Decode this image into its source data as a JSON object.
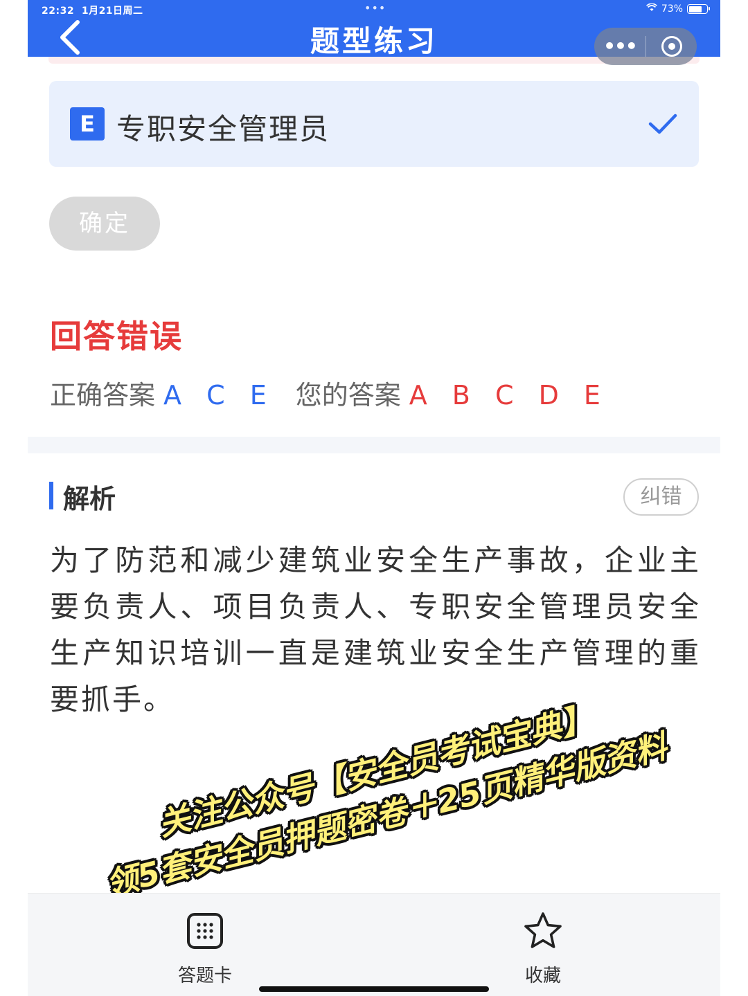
{
  "status_bar": {
    "time": "22:32",
    "date": "1月21日周二",
    "dots": "•••",
    "battery_percent": "73%",
    "battery_level": 0.73
  },
  "header": {
    "title": "题型练习",
    "back_icon": "chevron-left-icon",
    "more_icon": "more-dots-icon",
    "close_icon": "target-icon",
    "color": "#2f6bef"
  },
  "option": {
    "letter": "E",
    "text": "专职安全管理员",
    "selected": true
  },
  "confirm_label": "确定",
  "result": {
    "status": "回答错误",
    "correct_label": "正确答案",
    "correct_value": "A C E",
    "your_label": "您的答案",
    "your_value": "A B C D E"
  },
  "analysis": {
    "title": "解析",
    "report_label": "纠错",
    "text": "为了防范和减少建筑业安全生产事故，企业主要负责人、项目负责人、专职安全管理员安全生产知识培训一直是建筑业安全生产管理的重要抓手。"
  },
  "promo": {
    "line1": "关注公众号【安全员考试宝典】",
    "line2": "领5套安全员押题密卷＋25页精华版资料"
  },
  "bottom_bar": {
    "answer_card_label": "答题卡",
    "favorite_label": "收藏"
  },
  "colors": {
    "accent": "#2f6bef",
    "error": "#e63b3b",
    "option_bg": "#e9f0fd"
  }
}
